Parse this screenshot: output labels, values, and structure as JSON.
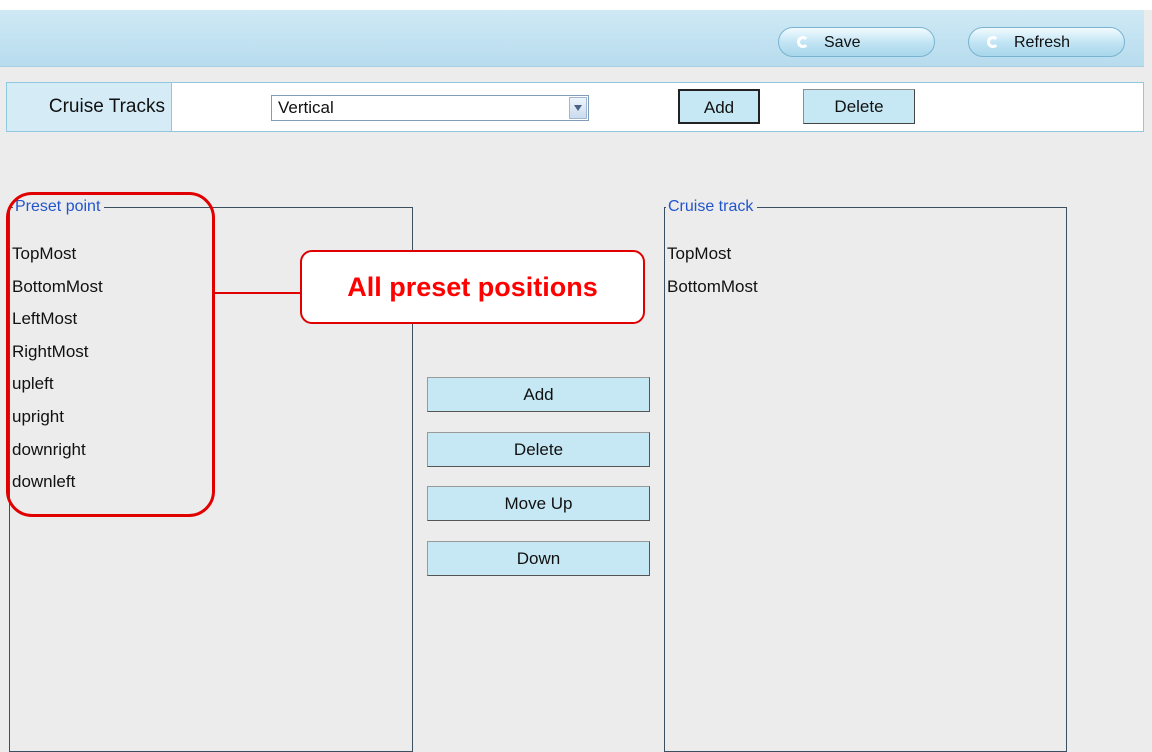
{
  "toolbar": {
    "save_label": "Save",
    "refresh_label": "Refresh"
  },
  "cruise_tracks": {
    "label": "Cruise Tracks",
    "selected": "Vertical",
    "add_label": "Add",
    "delete_label": "Delete"
  },
  "preset_point": {
    "legend": "Preset point",
    "items": [
      "TopMost",
      "BottomMost",
      "LeftMost",
      "RightMost",
      "upleft",
      "upright",
      "downright",
      "downleft"
    ]
  },
  "middle_buttons": {
    "add": "Add",
    "delete": "Delete",
    "move_up": "Move Up",
    "down": "Down"
  },
  "cruise_track": {
    "legend": "Cruise track",
    "items": [
      "TopMost",
      "BottomMost"
    ]
  },
  "annotation": {
    "text": "All preset positions",
    "color": "#ff0000"
  },
  "colors": {
    "toolbar_bg": "#b7dcee",
    "button_bg": "#c5e8f4",
    "legend_text": "#2255cc"
  }
}
